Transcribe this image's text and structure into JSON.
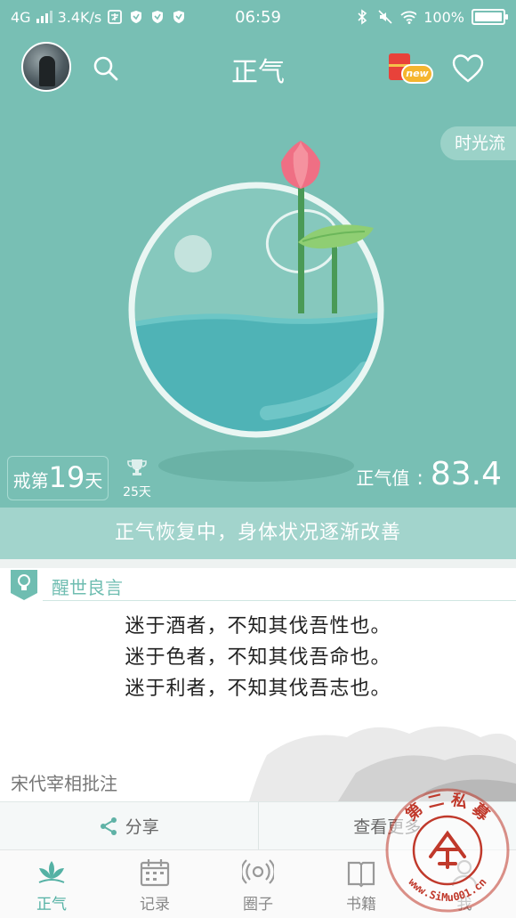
{
  "status_bar": {
    "network": "4G",
    "speed": "3.4K/s",
    "time": "06:59",
    "battery": "100%"
  },
  "header": {
    "title": "正气",
    "gift_badge": "new"
  },
  "hero": {
    "timeflow_label": "时光流",
    "abstain_prefix": "戒第",
    "abstain_days": "19",
    "abstain_suffix": "天",
    "record_days": "25天",
    "qi_label": "正气值",
    "qi_colon": ":",
    "qi_value": "83.4"
  },
  "status_message": "正气恢复中，身体状况逐渐改善",
  "quote_card": {
    "title": "醒世良言",
    "lines": [
      "迷于酒者，不知其伐吾性也。",
      "迷于色者，不知其伐吾命也。",
      "迷于利者，不知其伐吾志也。"
    ],
    "source": "宋代宰相批注"
  },
  "actions": {
    "share_label": "分享",
    "more_label": "查看更多"
  },
  "tabs": [
    {
      "label": "正气",
      "icon": "lotus-icon",
      "active": true
    },
    {
      "label": "记录",
      "icon": "calendar-icon",
      "active": false
    },
    {
      "label": "圈子",
      "icon": "broadcast-icon",
      "active": false
    },
    {
      "label": "书籍",
      "icon": "book-icon",
      "active": false
    },
    {
      "label": "我",
      "icon": "person-icon",
      "active": false
    }
  ],
  "watermark": {
    "top_text": "第 二 私 募",
    "bottom_text": "www.SiMu001.cn"
  },
  "colors": {
    "primary": "#78bfb4",
    "banner": "#a2d4cc",
    "accent": "#54b1a4",
    "lotus": "#ef6f84",
    "water": "#5ab5b8",
    "watermark": "#c0392b"
  }
}
